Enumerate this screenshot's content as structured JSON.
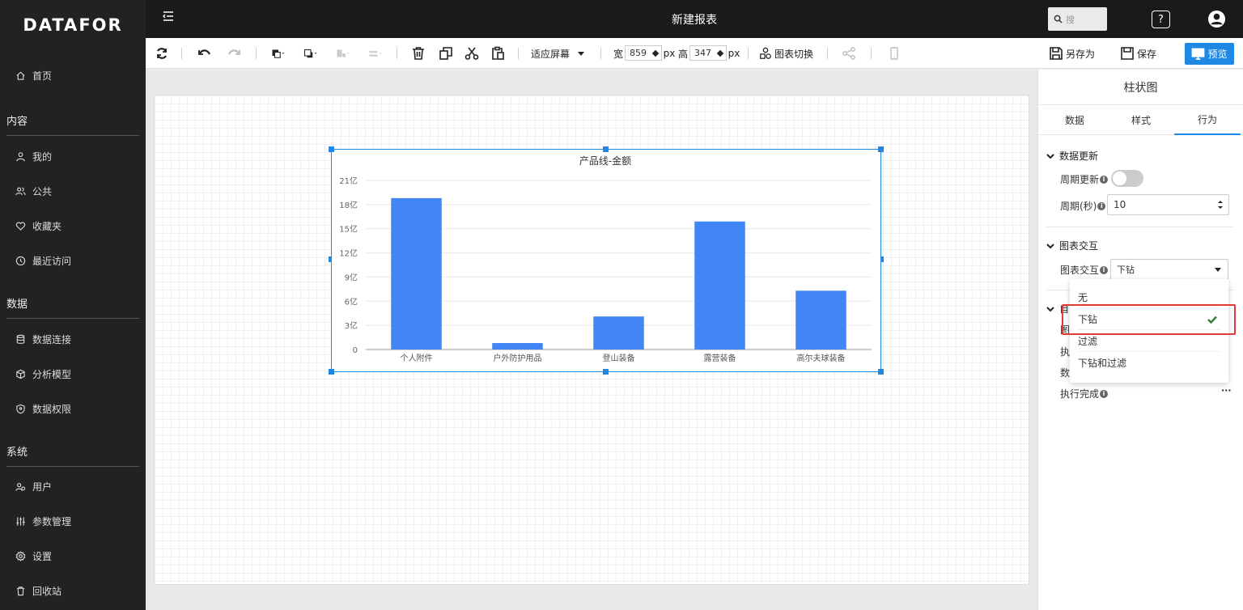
{
  "app": {
    "logo": "DATAFOR",
    "title": "新建报表"
  },
  "sidebar": {
    "home": "首页",
    "sections": {
      "content": "内容",
      "data": "数据",
      "system": "系统"
    },
    "content_items": [
      "我的",
      "公共",
      "收藏夹",
      "最近访问"
    ],
    "data_items": [
      "数据连接",
      "分析模型",
      "数据权限"
    ],
    "system_items": [
      "用户",
      "参数管理",
      "设置",
      "回收站"
    ]
  },
  "topbar": {
    "search_placeholder": "搜",
    "help": "?"
  },
  "toolbar": {
    "fit_label": "适应屏幕",
    "width_label": "宽",
    "width_value": "859",
    "height_label": "高",
    "height_value": "347",
    "unit": "px",
    "chart_switch": "图表切换",
    "save_as": "另存为",
    "save": "保存",
    "preview": "预览"
  },
  "chart_data": {
    "type": "bar",
    "title": "产品线-金额",
    "categories": [
      "个人附件",
      "户外防护用品",
      "登山装备",
      "露营装备",
      "高尔夫球装备"
    ],
    "values": [
      18.8,
      0.8,
      4.1,
      15.9,
      7.3
    ],
    "unit_suffix": "亿",
    "yticks": [
      "0",
      "3亿",
      "6亿",
      "9亿",
      "12亿",
      "15亿",
      "18亿",
      "21亿"
    ],
    "ylim": [
      0,
      21
    ],
    "bar_color": "#4285f4"
  },
  "panel": {
    "title": "柱状图",
    "tabs": [
      "数据",
      "样式",
      "行为"
    ],
    "active_tab": 2,
    "group_data_update": "数据更新",
    "periodic_update": "周期更新",
    "period_sec": "周期(秒)",
    "period_value": "10",
    "group_interaction": "图表交互",
    "interaction_label": "图表交互",
    "interaction_value": "下钻",
    "hidden_partial": [
      "自",
      "图",
      "执",
      "数"
    ],
    "exec_done": "执行完成",
    "more": "···"
  },
  "dropdown": {
    "options": [
      "无",
      "下钻",
      "过滤",
      "下钻和过滤"
    ],
    "selected": 1
  },
  "colors": {
    "accent": "#1e88e5",
    "highlight": "#e53935",
    "check": "#2e7d32"
  }
}
